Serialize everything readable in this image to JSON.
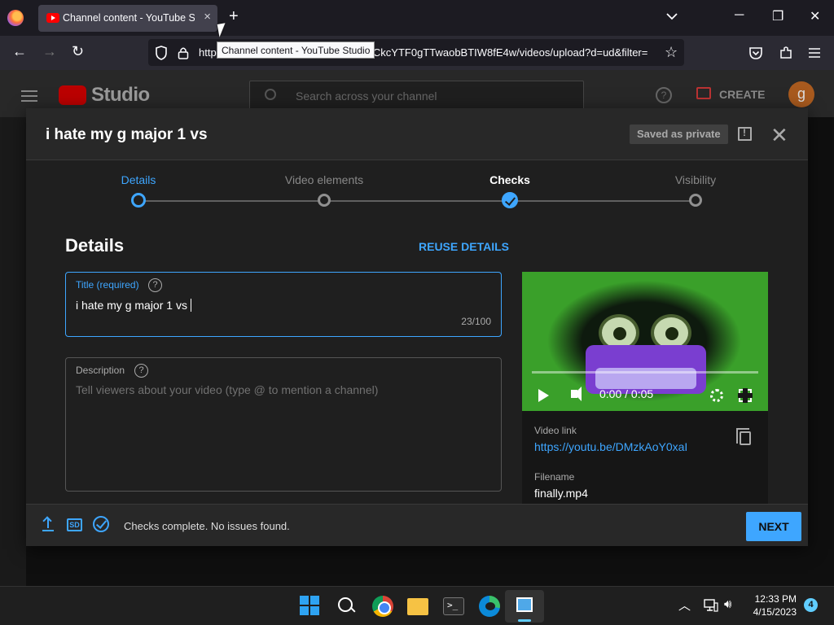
{
  "browser": {
    "tab_title": "Channel content - YouTube Studio",
    "tab_close": "×",
    "new_tab": "+",
    "url": "https://studio.youtube.com/channel/UCkcYTF0gTTwaobBTIW8fE4w/videos/upload?d=ud&filter=",
    "tooltip": "Channel content - YouTube Studio",
    "win_min": "─",
    "win_max": "❐",
    "win_close": "✕"
  },
  "studio": {
    "logo_text": "Studio",
    "search_placeholder": "Search across your channel",
    "help": "?",
    "create_label": "CREATE",
    "avatar_letter": "g"
  },
  "modal": {
    "title": "i hate my g major 1 vs",
    "saved_badge": "Saved as private",
    "close": "✕",
    "steps": [
      {
        "label": "Details",
        "state": "active"
      },
      {
        "label": "Video elements",
        "state": "todo"
      },
      {
        "label": "Checks",
        "state": "done"
      },
      {
        "label": "Visibility",
        "state": "todo"
      }
    ],
    "section_title": "Details",
    "reuse_label": "REUSE DETAILS",
    "title_field": {
      "label": "Title (required)",
      "value": "i hate my g major 1 vs",
      "count": "23/100"
    },
    "description_field": {
      "label": "Description",
      "placeholder": "Tell viewers about your video (type @ to mention a channel)"
    },
    "preview": {
      "time": "0:00 / 0:05",
      "video_link_label": "Video link",
      "video_link": "https://youtu.be/DMzkAoY0xaI",
      "filename_label": "Filename",
      "filename": "finally.mp4"
    },
    "footer": {
      "sd_badge": "SD",
      "status": "Checks complete. No issues found.",
      "next_label": "NEXT"
    }
  },
  "taskbar": {
    "time": "12:33 PM",
    "date": "4/15/2023",
    "notifications": "4",
    "tray_chevron": "︿"
  },
  "colors": {
    "accent": "#3ea6ff",
    "modal_bg": "#282828",
    "body_bg": "#1f1f1f"
  }
}
